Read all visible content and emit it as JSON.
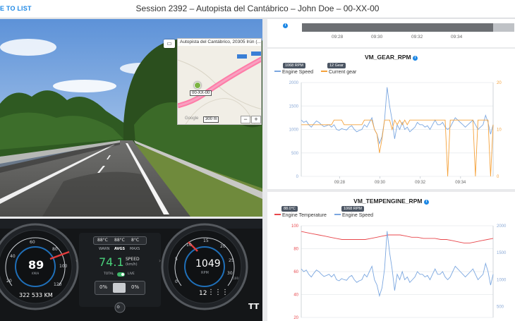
{
  "header": {
    "back_label": "E TO LIST",
    "title": "Session 2392 – Autopista del Cantábrico – John Doe – 00-XX-00"
  },
  "map": {
    "caption": "Autopista del Cantábrico, 20305 Irún (...",
    "marker_label": "00-XX-00",
    "scale": "300 m",
    "google": "Google",
    "zoom_out": "−",
    "zoom_in": "+",
    "road_badges": [
      "E-70",
      "E-80"
    ]
  },
  "dashboard": {
    "speed_value": "89",
    "speed_unit": "KM/H",
    "odometer": "322 533 KM",
    "speed_ticks": [
      "20",
      "40",
      "60",
      "80",
      "100",
      "120"
    ],
    "temps": [
      "88°C",
      "88°C",
      "8°C"
    ],
    "labels": [
      "WARN",
      "AVGS",
      "MAXS"
    ],
    "avg_speed": "74.1",
    "avg_speed_label": "SPEED",
    "avg_speed_unit": "(km/h)",
    "total_label": "TOTAL",
    "live_label": "LIVE",
    "pct_left": "0%",
    "pct_right": "0%",
    "rpm_value": "1049",
    "rpm_unit": "RPM",
    "rpm_ticks": [
      "0",
      "5",
      "10",
      "15",
      "20",
      "25",
      "30"
    ],
    "rpm_multiplier": "x100",
    "gear": "12",
    "logo": "TT"
  },
  "timeline": {
    "ticks": [
      "09:28",
      "09:30",
      "09:32",
      "09:34"
    ],
    "info_glyph": "i"
  },
  "chart_data": [
    {
      "type": "line",
      "title": "VM_GEAR_RPM",
      "badges": [
        "1068 RPM",
        "12 Gear"
      ],
      "x_ticks": [
        "09:28",
        "09:30",
        "09:32",
        "09:34"
      ],
      "y_left_ticks": [
        "0",
        "500",
        "1000",
        "1500",
        "2000"
      ],
      "y_right_ticks": [
        "0",
        "10",
        "20"
      ],
      "ylim_left": [
        0,
        2000
      ],
      "ylim_right": [
        0,
        20
      ],
      "series": [
        {
          "name": "Engine Speed",
          "color": "#7ba7e0",
          "axis": "left",
          "values": [
            1200,
            1150,
            1180,
            1100,
            1050,
            1120,
            1180,
            1150,
            1100,
            1060,
            1080,
            1100,
            1050,
            1100,
            1000,
            980,
            1020,
            1000,
            990,
            1050,
            1080,
            1000,
            950,
            980,
            1000,
            1100,
            1050,
            1150,
            1250,
            1000,
            900,
            700,
            850,
            1200,
            1900,
            1500,
            1200,
            800,
            1100,
            1000,
            1150,
            1000,
            1050,
            950,
            1000,
            1050,
            1150,
            1100,
            1100,
            1050,
            1080,
            1000,
            1100,
            1200,
            1100,
            1100,
            1150,
            1050,
            1000,
            1050,
            1150,
            1250,
            1200,
            1150,
            1100,
            1050,
            1100,
            1150,
            1200,
            1100,
            1000,
            1050,
            1100,
            1300,
            1150,
            900,
            1100
          ]
        },
        {
          "name": "Current gear",
          "color": "#f5a23b",
          "axis": "right",
          "values": [
            11,
            11,
            11,
            11,
            11,
            11,
            11,
            11,
            11,
            11,
            11,
            11,
            11,
            12,
            12,
            12,
            12,
            11,
            11,
            11,
            11,
            11,
            11,
            11,
            11,
            12,
            12,
            12,
            12,
            10,
            9,
            5,
            8,
            12,
            12,
            12,
            10,
            12,
            11,
            12,
            11,
            12,
            11,
            12,
            12,
            12,
            12,
            12,
            12,
            12,
            12,
            12,
            12,
            12,
            12,
            12,
            12,
            12,
            0,
            12,
            12,
            12,
            12,
            12,
            12,
            12,
            12,
            12,
            12,
            0,
            12,
            12,
            12,
            12,
            12,
            0,
            11
          ]
        }
      ]
    },
    {
      "type": "line",
      "title": "VM_TEMPENGINE_RPM",
      "badges": [
        "88.0°C",
        "1068 RPM"
      ],
      "y_left_ticks": [
        "20",
        "40",
        "60",
        "80",
        "100"
      ],
      "y_right_ticks": [
        "500",
        "1000",
        "1500",
        "2000"
      ],
      "ylim_left": [
        20,
        100
      ],
      "ylim_right": [
        300,
        2000
      ],
      "series": [
        {
          "name": "Engine Temperature",
          "color": "#e8474c",
          "axis": "left",
          "values": [
            95,
            94,
            93,
            92,
            91,
            90,
            89,
            88,
            88,
            88,
            88,
            88,
            89,
            90,
            91,
            92,
            92,
            92,
            91,
            90,
            90,
            89,
            89,
            89,
            88,
            88,
            87,
            86,
            85,
            85,
            86,
            87,
            88,
            89
          ]
        },
        {
          "name": "Engine Speed",
          "color": "#7ba7e0",
          "axis": "right",
          "values": [
            1200,
            1150,
            1180,
            1100,
            1050,
            1120,
            1180,
            1150,
            1100,
            1060,
            1080,
            1100,
            1050,
            1100,
            1000,
            980,
            1020,
            1000,
            990,
            1050,
            1080,
            1000,
            950,
            980,
            1000,
            1100,
            1050,
            1150,
            1250,
            1000,
            900,
            700,
            850,
            1200,
            1900,
            1500,
            1200,
            800,
            1100,
            1000,
            1150,
            1000,
            1050,
            950,
            1000,
            1050,
            1150,
            1100,
            1100,
            1050,
            1080,
            1000,
            1100,
            1200,
            1100,
            1100,
            1150,
            1050,
            1000,
            1050,
            1150,
            1250,
            1200,
            1150,
            1100,
            1050,
            1100,
            1150,
            1200,
            1100,
            1000,
            1050,
            1100,
            1300,
            1150,
            900,
            1100
          ]
        }
      ]
    }
  ]
}
